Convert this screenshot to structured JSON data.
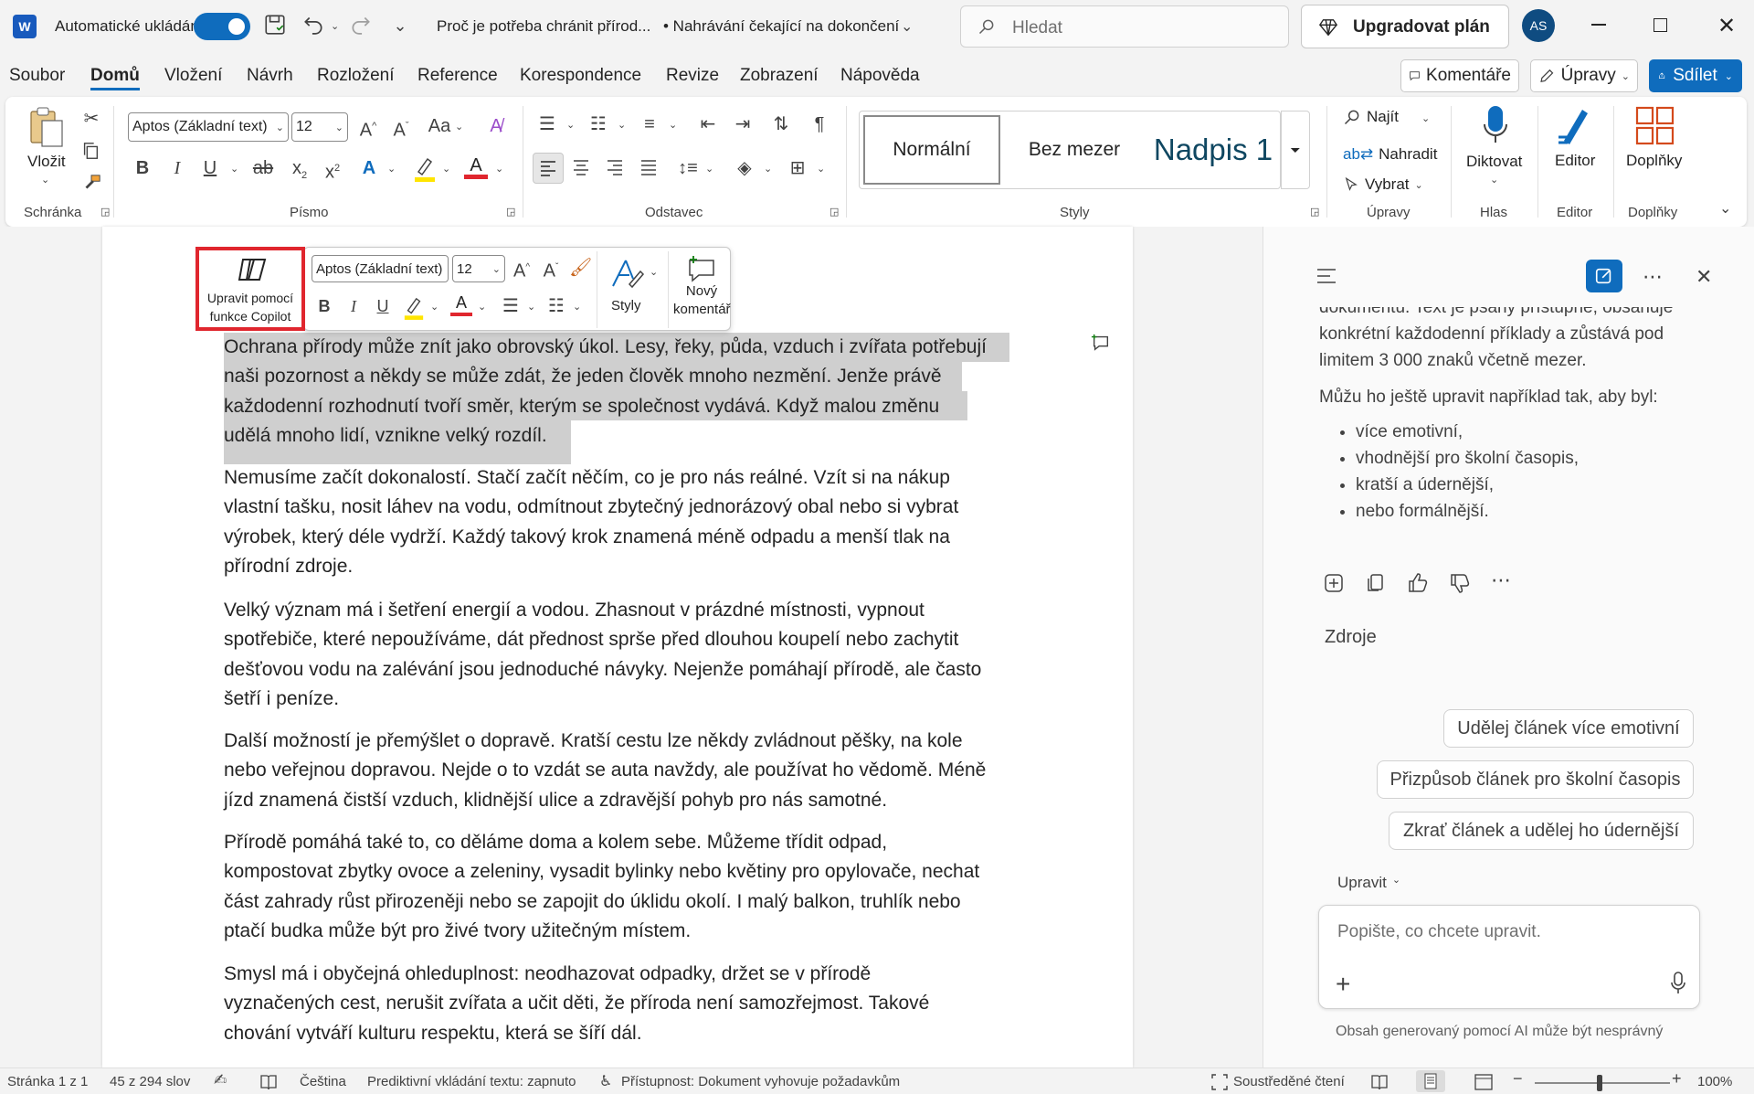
{
  "titlebar": {
    "autosave_label": "Automatické ukládání",
    "doc_title": "Proč je potřeba chránit přírod...",
    "upload_status": "• Nahrávání čekající na dokončení",
    "search_placeholder": "Hledat",
    "upgrade_label": "Upgradovat plán",
    "avatar_initials": "AS"
  },
  "menu": {
    "tabs": [
      "Soubor",
      "Domů",
      "Vložení",
      "Návrh",
      "Rozložení",
      "Reference",
      "Korespondence",
      "Revize",
      "Zobrazení",
      "Nápověda"
    ],
    "comments_label": "Komentáře",
    "editing_label": "Úpravy",
    "share_label": "Sdílet"
  },
  "ribbon": {
    "paste_label": "Vložit",
    "clipboard_group": "Schránka",
    "font_name": "Aptos (Základní text)",
    "font_size": "12",
    "font_group": "Písmo",
    "paragraph_group": "Odstavec",
    "styles": [
      "Normální",
      "Bez mezer",
      "Nadpis 1"
    ],
    "styles_group": "Styly",
    "find_label": "Najít",
    "replace_label": "Nahradit",
    "select_label": "Vybrat",
    "editing_group": "Úpravy",
    "dictate_label": "Diktovat",
    "voice_group": "Hlas",
    "editor_label": "Editor",
    "editor_group": "Editor",
    "addins_label": "Doplňky",
    "addins_group": "Doplňky"
  },
  "floating_toolbar": {
    "copilot_label_1": "Upravit pomocí",
    "copilot_label_2": "funkce Copilot",
    "font_name": "Aptos (Základní text)",
    "font_size": "12",
    "styles_label": "Styly",
    "new_comment_1": "Nový",
    "new_comment_2": "komentář"
  },
  "document": {
    "paragraphs": [
      [
        "Ochrana přírody může znít jako obrovský úkol. Lesy, řeky, půda, vzduch i zvířata potřebují",
        "naši pozornost a někdy se může zdát, že jeden člověk mnoho nezmění. Jenže právě",
        "každodenní rozhodnutí tvoří směr, kterým se společnost vydává. Když malou změnu",
        "udělá mnoho lidí, vznikne velký rozdíl."
      ],
      [
        "Nemusíme začít dokonalostí. Stačí začít něčím, co je pro nás reálné. Vzít si na nákup",
        "vlastní tašku, nosit láhev na vodu, odmítnout zbytečný jednorázový obal nebo si vybrat",
        "výrobek, který déle vydrží. Každý takový krok znamená méně odpadu a menší tlak na",
        "přírodní zdroje."
      ],
      [
        "Velký význam má i šetření energií a vodou. Zhasnout v prázdné místnosti, vypnout",
        "spotřebiče, které nepoužíváme, dát přednost sprše před dlouhou koupelí nebo zachytit",
        "dešťovou vodu na zalévání jsou jednoduché návyky. Nejenže pomáhají přírodě, ale často",
        "šetří i peníze."
      ],
      [
        "Další možností je přemýšlet o dopravě. Kratší cestu lze někdy zvládnout pěšky, na kole",
        "nebo veřejnou dopravou. Nejde o to vzdát se auta navždy, ale používat ho vědomě. Méně",
        "jízd znamená čistší vzduch, klidnější ulice a zdravější pohyb pro nás samotné."
      ],
      [
        "Přírodě pomáhá také to, co děláme doma a kolem sebe. Můžeme třídit odpad,",
        "kompostovat zbytky ovoce a zeleniny, vysadit bylinky nebo květiny pro opylovače, nechat",
        "část zahrady růst přirozeněji nebo se zapojit do úklidu okolí. I malý balkon, truhlík nebo",
        "ptačí budka může být pro živé tvory užitečným místem."
      ],
      [
        "Smysl má i obyčejná ohleduplnost: neodhazovat odpadky, držet se v přírodě",
        "vyznačených cest, nerušit zvířata a učit děti, že příroda není samozřejmost. Takové",
        "chování vytváří kulturu respektu, která se šíří dál."
      ]
    ]
  },
  "copilot_panel": {
    "intro_lines": [
      "dokumentu. Text je psaný přístupně, obsahuje",
      "konkrétní každodenní příklady a zůstává pod",
      "limitem 3 000 znaků včetně mezer."
    ],
    "offer": "Můžu ho ještě upravit například tak, aby byl:",
    "bullets": [
      "více emotivní,",
      "vhodnější pro školní časopis,",
      "kratší a údernější,",
      "nebo formálnější."
    ],
    "sources_label": "Zdroje",
    "suggestions": [
      "Udělej článek více emotivní",
      "Přizpůsob článek pro školní časopis",
      "Zkrať článek a udělej ho údernější"
    ],
    "mode_label": "Upravit",
    "input_placeholder": "Popište, co chcete upravit.",
    "disclaimer": "Obsah generovaný pomocí AI může být nesprávný"
  },
  "statusbar": {
    "page": "Stránka 1 z 1",
    "words": "45 z 294 slov",
    "language": "Čeština",
    "predictive": "Prediktivní vkládání textu: zapnuto",
    "accessibility": "Přístupnost: Dokument vyhovuje požadavkům",
    "focus": "Soustředěné čtení",
    "zoom": "100%"
  },
  "colors": {
    "accent": "#0f6cbd",
    "highlight_box": "#e0262e",
    "selection": "#cfcfcf"
  }
}
